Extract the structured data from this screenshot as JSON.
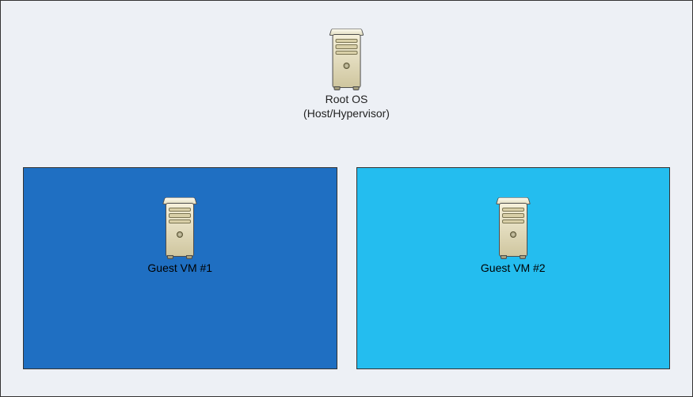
{
  "root": {
    "label_line1": "Root OS",
    "label_line2": "(Host/Hypervisor)"
  },
  "vms": [
    {
      "label": "Guest VM #1",
      "bg": "#1f6fc2"
    },
    {
      "label": "Guest VM #2",
      "bg": "#24bdef"
    }
  ]
}
